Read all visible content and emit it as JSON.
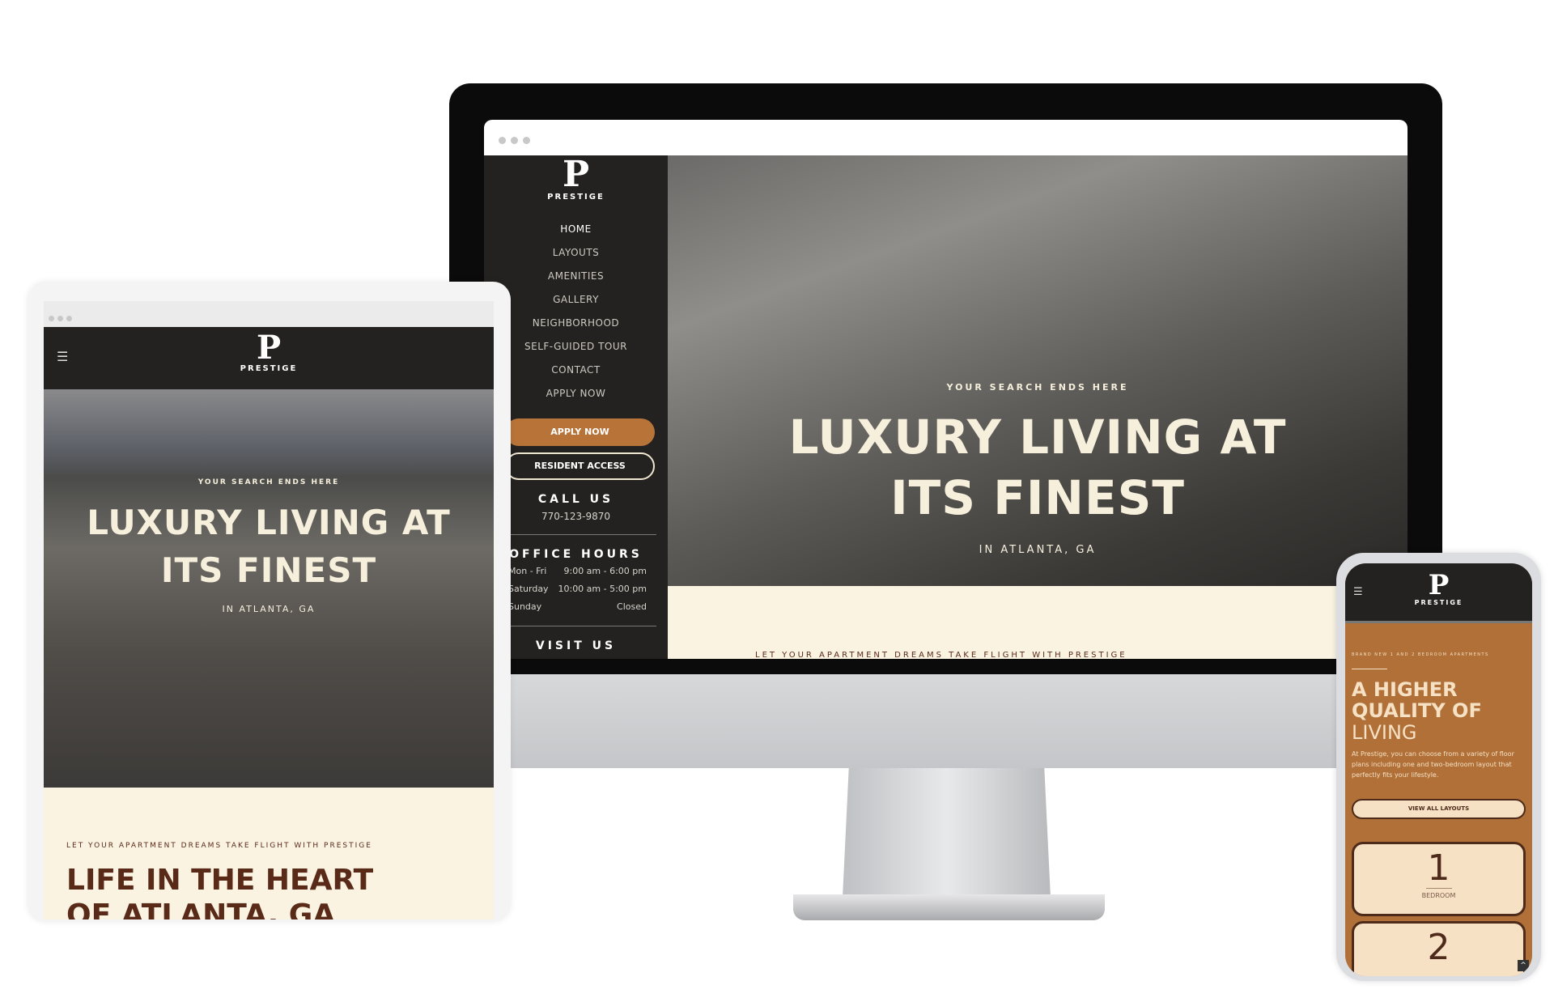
{
  "brand": {
    "name": "PRESTIGE",
    "logo_letter": "P"
  },
  "desktop": {
    "nav": [
      "HOME",
      "LAYOUTS",
      "AMENITIES",
      "GALLERY",
      "NEIGHBORHOOD",
      "SELF-GUIDED TOUR",
      "CONTACT",
      "APPLY NOW"
    ],
    "apply_button": "APPLY NOW",
    "resident_button": "RESIDENT ACCESS",
    "call_title": "CALL US",
    "phone": "770-123-9870",
    "hours_title": "OFFICE HOURS",
    "hours": [
      {
        "day": "Mon - Fri",
        "time": "9:00 am - 6:00 pm"
      },
      {
        "day": "Saturday",
        "time": "10:00 am - 5:00 pm"
      },
      {
        "day": "Sunday",
        "time": "Closed"
      }
    ],
    "visit_title": "VISIT US",
    "hero": {
      "eyebrow": "YOUR SEARCH ENDS HERE",
      "line1": "LUXURY LIVING AT",
      "line2": "ITS FINEST",
      "sub": "IN ATLANTA, GA"
    },
    "below": "LET YOUR APARTMENT DREAMS TAKE FLIGHT WITH PRESTIGE"
  },
  "tablet": {
    "hero": {
      "eyebrow": "YOUR SEARCH ENDS HERE",
      "line1": "LUXURY LIVING AT",
      "line2": "ITS FINEST",
      "sub": "IN ATLANTA, GA"
    },
    "eyebrow2": "LET YOUR APARTMENT DREAMS TAKE FLIGHT WITH PRESTIGE",
    "heading1": "LIFE IN THE HEART",
    "heading2": "OF ATLANTA, GA"
  },
  "phone": {
    "eyebrow": "BRAND NEW 1 AND 2 BEDROOM APARTMENTS",
    "heading": [
      "A HIGHER",
      "QUALITY OF",
      "LIVING"
    ],
    "body": "At Prestige, you can choose from a variety of floor plans including one and two-bedroom layout that perfectly fits your lifestyle.",
    "button": "VIEW ALL LAYOUTS",
    "cards": [
      {
        "num": "1",
        "label": "BEDROOM"
      },
      {
        "num": "2",
        "label": ""
      }
    ]
  },
  "colors": {
    "accent": "#b87438",
    "dark": "#232221",
    "cream": "#faf3e2",
    "brown": "#5a2a18"
  }
}
